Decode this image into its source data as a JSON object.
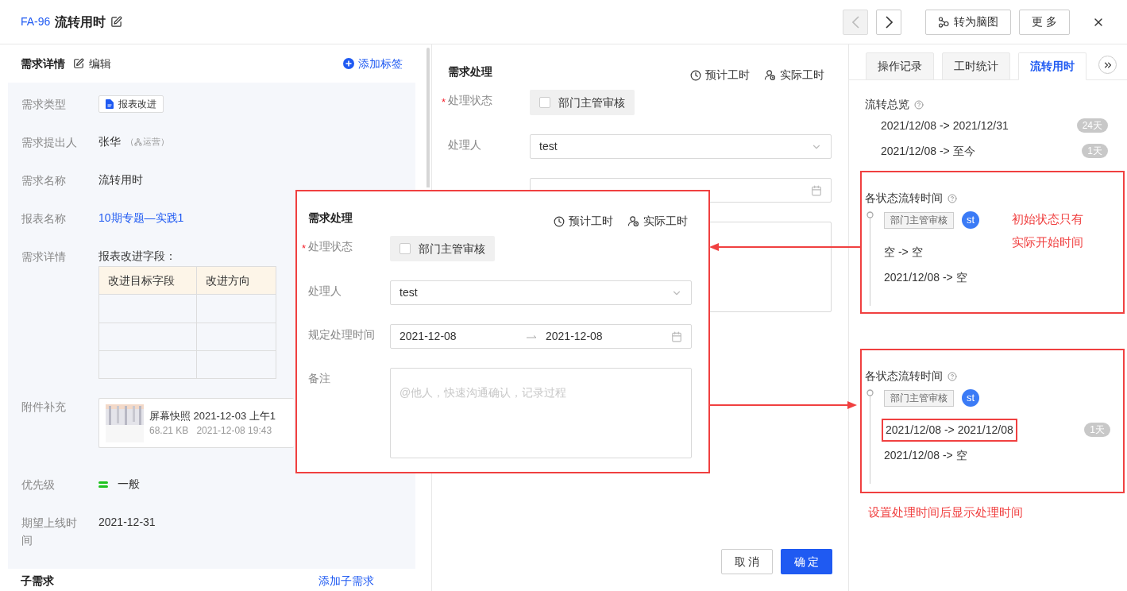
{
  "header": {
    "id": "FA-96",
    "title": "流转用时",
    "nav": [
      {
        "kind": "prev",
        "disabled": true
      },
      {
        "kind": "next",
        "disabled": false
      }
    ],
    "buttons": [
      {
        "kind": "mindmap",
        "label": "转为脑图"
      },
      {
        "kind": "more",
        "label": "更 多"
      }
    ]
  },
  "detail": {
    "title": "需求详情",
    "edit": "编辑",
    "add_tag": "添加标签",
    "fields": [
      {
        "kind": "tag",
        "label": "需求类型",
        "value": "报表改进"
      },
      {
        "kind": "person",
        "label": "需求提出人",
        "value": "张华",
        "dept_open": "（",
        "dept": "运营）"
      },
      {
        "kind": "text",
        "label": "需求名称",
        "value": "流转用时"
      },
      {
        "kind": "link",
        "label": "报表名称",
        "value": "10期专题—实践1"
      },
      {
        "kind": "table",
        "label": "需求详情",
        "value": "报表改进字段：",
        "columns": [
          "改进目标字段",
          "改进方向"
        ]
      },
      {
        "kind": "file",
        "label": "附件补充",
        "name": "屏幕快照 2021-12-03 上午1",
        "size": "68.21 KB",
        "time": "2021-12-08 19:43"
      },
      {
        "kind": "priority",
        "label": "优先级",
        "value": "一般",
        "color": "#1fc31f"
      },
      {
        "kind": "text",
        "label": "期望上线时间",
        "value": "2021-12-31"
      }
    ]
  },
  "subtasks": {
    "title": "子需求",
    "add": "添加子需求"
  },
  "process": {
    "title": "需求处理",
    "actions": [
      {
        "kind": "estimate",
        "label": "预计工时"
      },
      {
        "kind": "actual",
        "label": "实际工时"
      }
    ],
    "fields": [
      {
        "kind": "status",
        "required_mark": "*",
        "label": "处理状态",
        "option": "部门主管审核",
        "checked": false
      },
      {
        "kind": "select",
        "label": "处理人",
        "value": "test"
      },
      {
        "kind": "daterange"
      },
      {
        "kind": "textarea"
      }
    ],
    "buttons": [
      {
        "kind": "cancel",
        "label": "取 消"
      },
      {
        "kind": "confirm",
        "label": "确 定"
      }
    ]
  },
  "callout": {
    "title": "需求处理",
    "actions": [
      {
        "kind": "estimate",
        "label": "预计工时"
      },
      {
        "kind": "actual",
        "label": "实际工时"
      }
    ],
    "fields": [
      {
        "kind": "status",
        "required_mark": "*",
        "label": "处理状态",
        "option": "部门主管审核",
        "checked": false
      },
      {
        "kind": "select",
        "label": "处理人",
        "value": "test"
      },
      {
        "kind": "daterange",
        "label": "规定处理时间",
        "start": "2021-12-08",
        "end": "2021-12-08"
      },
      {
        "kind": "textarea",
        "label": "备注",
        "placeholder": "@他人，快速沟通确认，记录过程"
      }
    ]
  },
  "sidebar": {
    "tabs": [
      {
        "label": "操作记录",
        "selected": false
      },
      {
        "label": "工时统计",
        "selected": false
      },
      {
        "label": "流转用时",
        "selected": true
      }
    ],
    "overview": {
      "title": "流转总览",
      "rows": [
        {
          "range": "2021/12/08 -> 2021/12/31",
          "days": "24天"
        },
        {
          "range": "2021/12/08 -> 至今",
          "days": "1天"
        }
      ]
    },
    "sections": [
      {
        "title": "各状态流转时间",
        "status": "部门主管审核",
        "avatar": "st",
        "rows": [
          {
            "range": "空 -> 空",
            "highlighted": false
          },
          {
            "range": "2021/12/08 -> 空",
            "highlighted": false
          }
        ],
        "note": [
          "初始状态只有",
          "实际开始时间"
        ]
      },
      {
        "title": "各状态流转时间",
        "status": "部门主管审核",
        "avatar": "st",
        "rows": [
          {
            "range": "2021/12/08 -> 2021/12/08",
            "days": "1天",
            "highlighted": true
          },
          {
            "range": "2021/12/08 -> 空",
            "highlighted": false
          }
        ],
        "caption": "设置处理时间后显示处理时间"
      }
    ]
  }
}
